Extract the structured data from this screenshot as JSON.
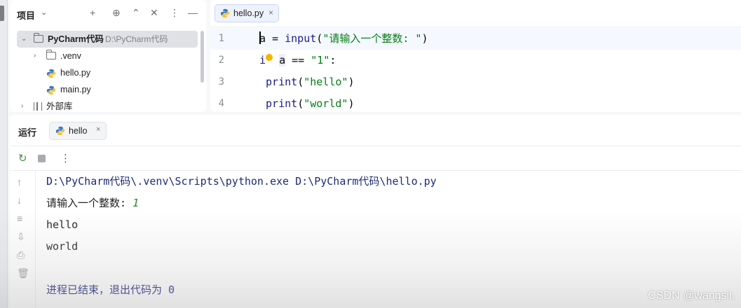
{
  "project_panel": {
    "title": "项目",
    "tools": [
      "+",
      "⊕",
      "⌃",
      "✕",
      "⋮",
      "—"
    ],
    "tree": [
      {
        "name": "PyCharm代码",
        "path": "D:\\PyCharm代码",
        "type": "folder",
        "expanded": true,
        "selected": true
      },
      {
        "name": ".venv",
        "type": "folder",
        "expanded": false
      },
      {
        "name": "hello.py",
        "type": "python-file"
      },
      {
        "name": "main.py",
        "type": "python-file"
      },
      {
        "name": "外部库",
        "type": "library",
        "expanded": false
      }
    ]
  },
  "editor": {
    "tab_label": "hello.py",
    "tab_close": "×",
    "lines": [
      {
        "num": "1",
        "var": "a",
        "rest_a": " = ",
        "fn": "input",
        "paren_open": "(",
        "str": "\"请输入一个整数: \"",
        "paren_close": ")"
      },
      {
        "num": "2",
        "kw_a": "i",
        "kw_b": " ",
        "var": "a",
        "op": " == ",
        "str": "\"1\"",
        "colon": ":"
      },
      {
        "num": "3",
        "indent": " ",
        "fn": "print",
        "paren_open": "(",
        "str": "\"hello\"",
        "paren_close": ")"
      },
      {
        "num": "4",
        "indent": " ",
        "fn": "print",
        "paren_open": "(",
        "str": "\"world\"",
        "paren_close": ")"
      }
    ]
  },
  "run_panel": {
    "title": "运行",
    "tab_label": "hello",
    "tab_close": "×",
    "console": {
      "command": "D:\\PyCharm代码\\.venv\\Scripts\\python.exe D:\\PyCharm代码\\hello.py",
      "prompt": "请输入一个整数: ",
      "user_input": "1",
      "out1": "hello",
      "out2": "world",
      "exit_message": "进程已结束，退出代码为 0"
    }
  },
  "watermark": "CSDN @wangsir."
}
